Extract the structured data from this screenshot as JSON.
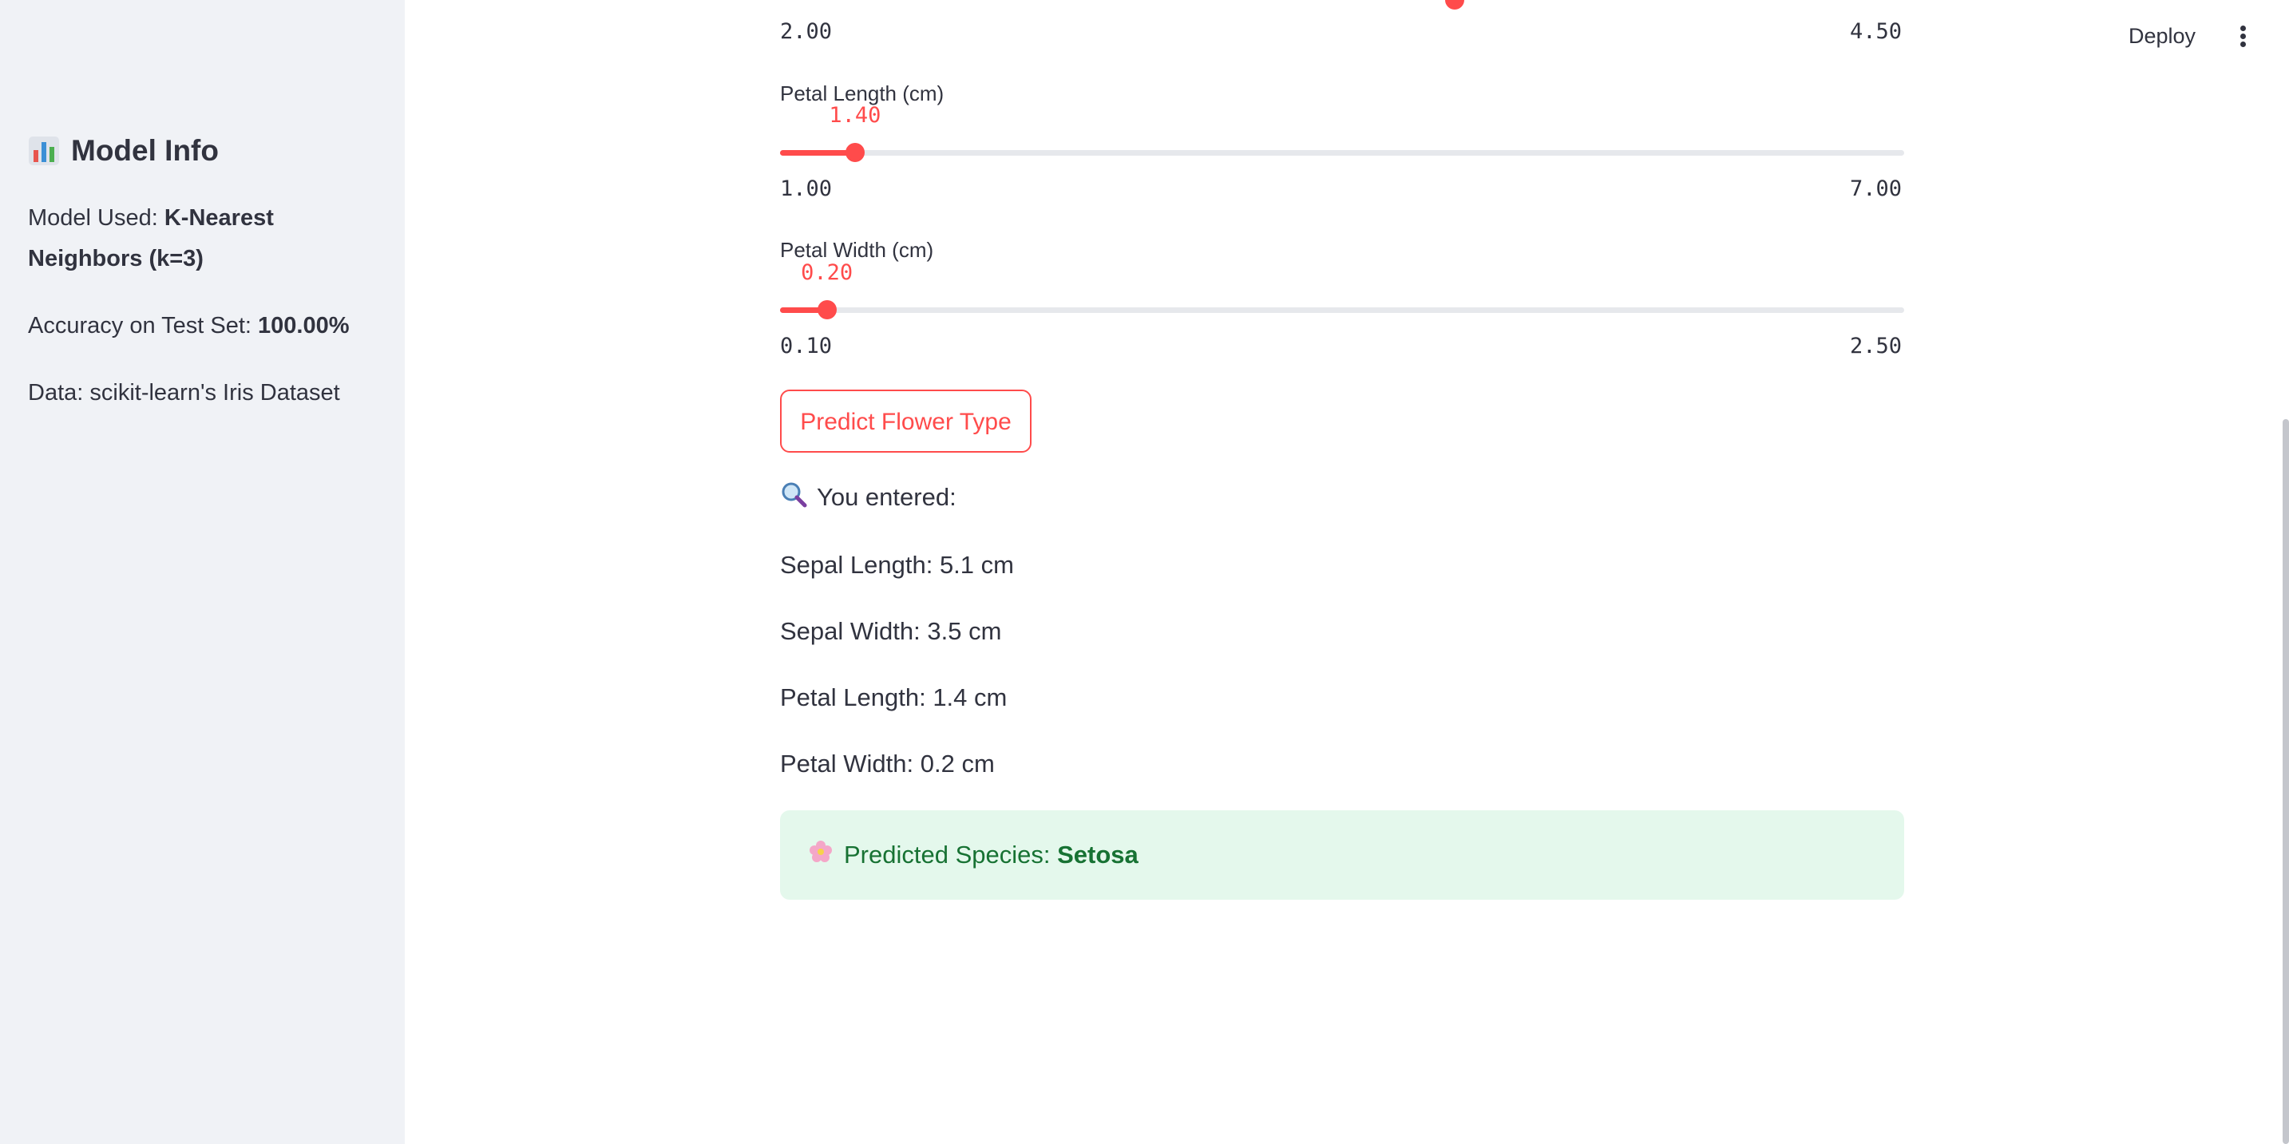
{
  "sidebar": {
    "title": "Model Info",
    "title_icon": "bar-chart-icon",
    "model_used_label": "Model Used: ",
    "model_used_value_line1": "K-Nearest",
    "model_used_value_line2": "Neighbors (k=3)",
    "accuracy_label": "Accuracy on Test Set: ",
    "accuracy_value": "100.00%",
    "data_text": "Data: scikit-learn's Iris Dataset"
  },
  "header": {
    "deploy_label": "Deploy",
    "menu_icon": "kebab-menu-icon"
  },
  "sliders": {
    "sepal_width": {
      "min_label": "2.00",
      "max_label": "4.50",
      "min": 2.0,
      "max": 4.5,
      "value": 3.5
    },
    "petal_length": {
      "label": "Petal Length (cm)",
      "value_label": "1.40",
      "min_label": "1.00",
      "max_label": "7.00",
      "min": 1.0,
      "max": 7.0,
      "value": 1.4
    },
    "petal_width": {
      "label": "Petal Width (cm)",
      "value_label": "0.20",
      "min_label": "0.10",
      "max_label": "2.50",
      "min": 0.1,
      "max": 2.5,
      "value": 0.2
    }
  },
  "predict_button": {
    "label": "Predict Flower Type"
  },
  "entered": {
    "heading": "You entered:",
    "heading_icon": "magnifier-icon",
    "sepal_length": "Sepal Length: 5.1 cm",
    "sepal_width": "Sepal Width: 3.5 cm",
    "petal_length": "Petal Length: 1.4 cm",
    "petal_width": "Petal Width: 0.2 cm"
  },
  "result": {
    "icon": "flower-icon",
    "label": "Predicted Species: ",
    "species": "Setosa"
  },
  "colors": {
    "accent": "#ff4b4b",
    "sidebar_bg": "#f0f2f6",
    "success_bg": "#e4f8ec",
    "success_text": "#177233",
    "text": "#31333f"
  }
}
